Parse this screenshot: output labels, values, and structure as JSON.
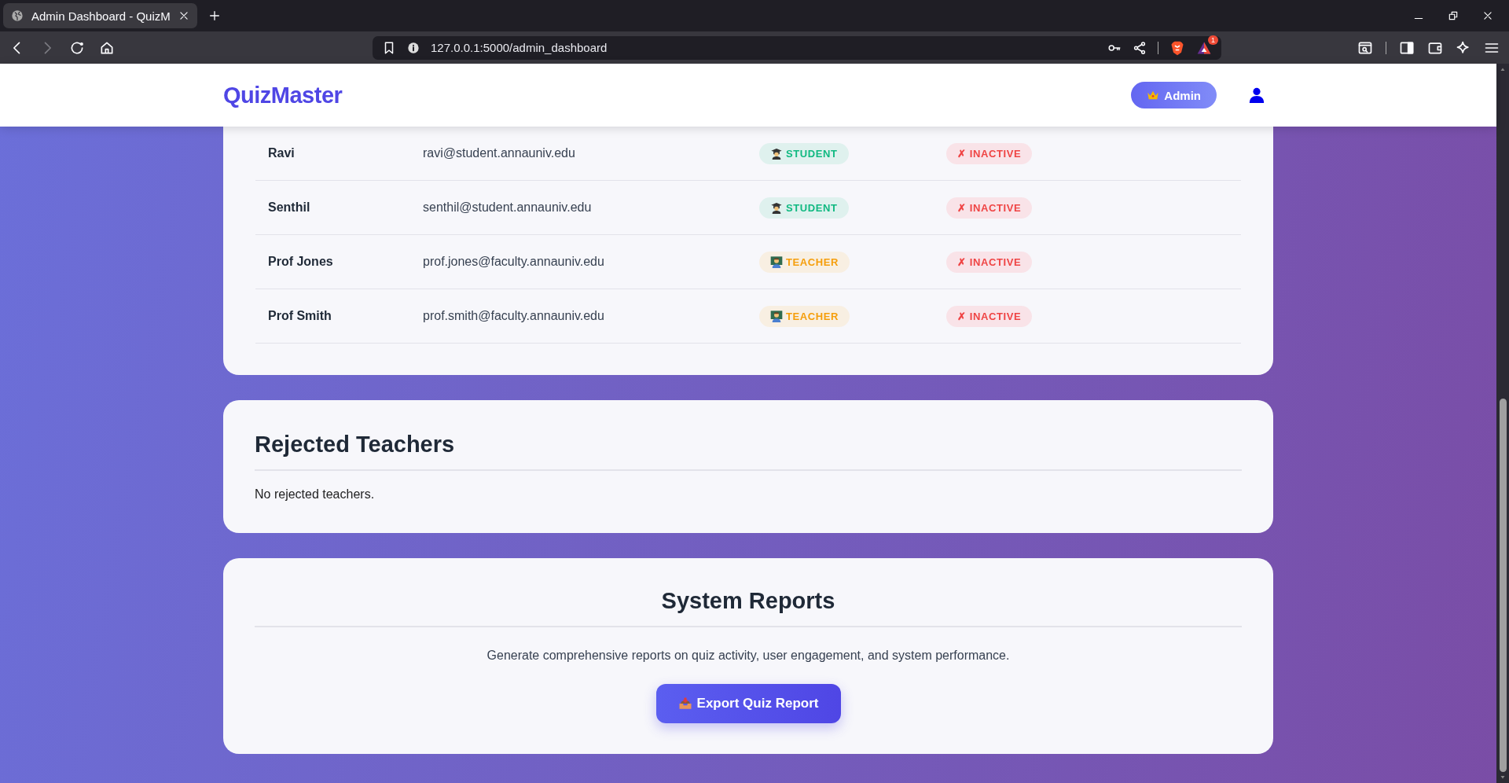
{
  "browser": {
    "tab_title": "Admin Dashboard - QuizM",
    "url": "127.0.0.1:5000/admin_dashboard",
    "back": {
      "disabled": false
    },
    "forward": {
      "disabled": true
    },
    "rewards_badge": "1"
  },
  "navbar": {
    "brand": "QuizMaster",
    "role_button": "Admin"
  },
  "users_table": {
    "rows": [
      {
        "name": "Ravi",
        "email": "ravi@student.annauniv.edu",
        "role": {
          "kind": "student",
          "label": "STUDENT"
        },
        "status": {
          "kind": "inactive",
          "label": "✗ INACTIVE"
        }
      },
      {
        "name": "Senthil",
        "email": "senthil@student.annauniv.edu",
        "role": {
          "kind": "student",
          "label": "STUDENT"
        },
        "status": {
          "kind": "inactive",
          "label": "✗ INACTIVE"
        }
      },
      {
        "name": "Prof Jones",
        "email": "prof.jones@faculty.annauniv.edu",
        "role": {
          "kind": "teacher",
          "label": "TEACHER"
        },
        "status": {
          "kind": "inactive",
          "label": "✗ INACTIVE"
        }
      },
      {
        "name": "Prof Smith",
        "email": "prof.smith@faculty.annauniv.edu",
        "role": {
          "kind": "teacher",
          "label": "TEACHER"
        },
        "status": {
          "kind": "inactive",
          "label": "✗ INACTIVE"
        }
      }
    ]
  },
  "rejected_teachers": {
    "title": "Rejected Teachers",
    "empty_message": "No rejected teachers."
  },
  "system_reports": {
    "title": "System Reports",
    "description": "Generate comprehensive reports on quiz activity, user engagement, and system performance.",
    "export_button": "Export Quiz Report"
  }
}
